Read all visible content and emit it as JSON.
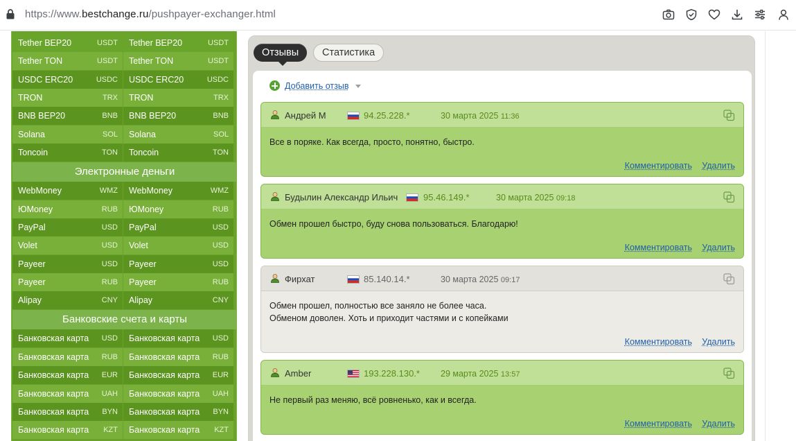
{
  "browser": {
    "url_scheme": "https://www.",
    "url_host": "bestchange.ru",
    "url_path": "/pushpayer-exchanger.html"
  },
  "currencies": {
    "crypto_rows": [
      {
        "name": "Tether BEP20",
        "code": "USDT"
      },
      {
        "name": "Tether TON",
        "code": "USDT"
      },
      {
        "name": "USDC ERC20",
        "code": "USDC"
      },
      {
        "name": "TRON",
        "code": "TRX"
      },
      {
        "name": "BNB BEP20",
        "code": "BNB"
      },
      {
        "name": "Solana",
        "code": "SOL"
      },
      {
        "name": "Toncoin",
        "code": "TON"
      }
    ],
    "section_emoney": "Электронные деньги",
    "emoney_rows": [
      {
        "name": "WebMoney",
        "code": "WMZ"
      },
      {
        "name": "ЮMoney",
        "code": "RUB"
      },
      {
        "name": "PayPal",
        "code": "USD"
      },
      {
        "name": "Volet",
        "code": "USD"
      },
      {
        "name": "Payeer",
        "code": "USD"
      },
      {
        "name": "Payeer",
        "code": "RUB"
      },
      {
        "name": "Alipay",
        "code": "CNY"
      }
    ],
    "section_banks": "Банковские счета и карты",
    "bank_rows": [
      {
        "name": "Банковская карта",
        "code": "USD"
      },
      {
        "name": "Банковская карта",
        "code": "RUB"
      },
      {
        "name": "Банковская карта",
        "code": "EUR"
      },
      {
        "name": "Банковская карта",
        "code": "UAH"
      },
      {
        "name": "Банковская карта",
        "code": "BYN"
      },
      {
        "name": "Банковская карта",
        "code": "KZT"
      }
    ]
  },
  "tabs": {
    "reviews": "Отзывы",
    "stats": "Статистика"
  },
  "add_review": "Добавить отзыв",
  "reviews": [
    {
      "author": "Андрей М",
      "ip": "94.25.228.*",
      "date": "30 марта 2025",
      "time": "11:36",
      "text": "Все в поряке. Как всегда, просто, понятно, быстро.",
      "comment": "Комментировать",
      "delete": "Удалить"
    },
    {
      "author": "Будылин Александр Ильич",
      "ip": "95.46.149.*",
      "date": "30 марта 2025",
      "time": "09:18",
      "text": "Обмен прошел быстро, буду снова пользоваться. Благодарю!",
      "comment": "Комментировать",
      "delete": "Удалить"
    },
    {
      "author": "Фирхат",
      "ip": "85.140.14.*",
      "date": "30 марта 2025",
      "time": "09:17",
      "text": "Обмен прошел, полностью все заняло не более часа.\nОбменом доволен. Хоть и приходит частями и с копейками",
      "comment": "Комментировать",
      "delete": "Удалить"
    },
    {
      "author": "Amber",
      "ip": "193.228.130.*",
      "date": "29 марта 2025",
      "time": "13:57",
      "text": "Не первый раз меняю, всё ровненько, как и всегда.",
      "comment": "Комментировать",
      "delete": "Удалить"
    }
  ]
}
